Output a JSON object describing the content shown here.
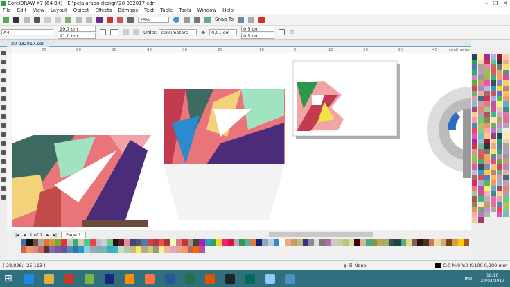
{
  "window": {
    "title": "CorelDRAW X7 (64-Bit) - E:\\pelajaraan design\\20 032017.cdr"
  },
  "menu": [
    "File",
    "Edit",
    "View",
    "Layout",
    "Object",
    "Effects",
    "Bitmaps",
    "Text",
    "Table",
    "Tools",
    "Window",
    "Help"
  ],
  "toolbar": {
    "zoom": "25%",
    "snap_to": "Snap To"
  },
  "property_bar": {
    "paper": "A4",
    "width": "29,7 cm",
    "height": "21,0 cm",
    "units_label": "Units:",
    "units": "centimeters",
    "nudge": "0,01 cm",
    "dup_x": "0,5 cm",
    "dup_y": "0,5 cm"
  },
  "document_tab": "20 032017.cdr",
  "ruler": {
    "ticks": [
      "70",
      "60",
      "50",
      "40",
      "30",
      "20",
      "10",
      "0",
      "10",
      "20",
      "30",
      "40"
    ],
    "unit": "centimeters"
  },
  "page_nav": {
    "count": "1 of 1",
    "page": "Page 1"
  },
  "status": {
    "coords": "(-28,026; -25,113 )",
    "fill": "None",
    "outline": "C:0 M:0 Y:0 K:100  0,200 mm"
  },
  "taskbar": {
    "time": "18:10",
    "date": "20/03/2017",
    "lang": "IND",
    "apps": [
      "#1e88e5",
      "#e0b040",
      "#c0392b",
      "#7cb342",
      "#1a237e",
      "#ff8f00",
      "#ff7043",
      "#2b579a",
      "#217346",
      "#e65100",
      "#222",
      "#00695c",
      "#90caf9",
      "#4a90c0"
    ]
  },
  "palette": [
    "#4a6fa5",
    "#111",
    "#6b4c3b",
    "#aaa",
    "#e8742c",
    "#c94",
    "#7a3",
    "#d34",
    "#bcb",
    "#3a8",
    "#dca",
    "#4c9",
    "#e44",
    "#bbc",
    "#ccd",
    "#6c8",
    "#211",
    "#523",
    "#e89",
    "#447",
    "#556",
    "#57a",
    "#c43",
    "#b35",
    "#e53",
    "#a34",
    "#efb",
    "#d78",
    "#c33",
    "#998",
    "#444",
    "#a2a",
    "#39c",
    "#2a5",
    "#fc3",
    "#e27",
    "#d14",
    "#aac",
    "#395",
    "#6a9",
    "#e73",
    "#127",
    "#8ab",
    "#bcd",
    "#38c",
    "#fff",
    "#ea7",
    "#c96",
    "#bb8",
    "#337",
    "#889",
    "#ddd",
    "#877",
    "#b6b",
    "#ccb",
    "#cca",
    "#ac7",
    "#dda",
    "#401",
    "#cb9",
    "#4a8",
    "#795",
    "#ba5",
    "#aa6",
    "#354",
    "#244",
    "#5a8",
    "#dd8",
    "#765",
    "#311",
    "#432",
    "#c76",
    "#ed9",
    "#ca8",
    "#741",
    "#d94",
    "#fc0",
    "#a52",
    "#c64",
    "#e96",
    "#d88",
    "#c66",
    "#533",
    "#86a",
    "#75a",
    "#659",
    "#58b",
    "#37a",
    "#29c",
    "#9cd",
    "#9ab",
    "#8aa",
    "#6bb",
    "#4ab",
    "#3bc",
    "#cdb",
    "#aca",
    "#cb7",
    "#ee6",
    "#ba8",
    "#cc8",
    "#997",
    "#fe9",
    "#eb9",
    "#dab",
    "#da9",
    "#e96",
    "#b66",
    "#f60",
    "#a5a"
  ],
  "right_palette": [
    "#246",
    "#fe9",
    "#a2a",
    "#9bd",
    "#a13",
    "#fc9",
    "#2a5",
    "#ecc",
    "#c34",
    "#6b9",
    "#333",
    "#ea8",
    "#57a",
    "#aa8",
    "#e8a",
    "#c66",
    "#777",
    "#fd6",
    "#3a6",
    "#b9c",
    "#8c4",
    "#d55",
    "#ea4",
    "#689",
    "#c8b",
    "#999",
    "#ba5",
    "#4a8",
    "#f96",
    "#e48",
    "#6a4",
    "#c97",
    "#e5a",
    "#355",
    "#88b",
    "#ec7",
    "#d44",
    "#a8c",
    "#bbd",
    "#39c",
    "#fc3",
    "#b86",
    "#7a8",
    "#ea9",
    "#a66",
    "#c55",
    "#57c",
    "#fb5",
    "#d9a",
    "#468",
    "#c35",
    "#aad",
    "#5b5",
    "#e96",
    "#8bc",
    "#c9a",
    "#e77",
    "#b5a",
    "#fe6",
    "#6ac",
    "#a47",
    "#d86",
    "#9c9",
    "#c58",
    "#ebb",
    "#488",
    "#fc8",
    "#b9a",
    "#a55",
    "#3b8",
    "#cab",
    "#d7a",
    "#e9b",
    "#6c7",
    "#885",
    "#fdb",
    "#aa5",
    "#e6a",
    "#58a",
    "#bb6",
    "#d96",
    "#7a6",
    "#c8d",
    "#aaa",
    "#e45",
    "#8c8",
    "#fa9",
    "#b7c",
    "#aba",
    "#eee",
    "#d5b",
    "#7bb",
    "#ec9",
    "#946"
  ]
}
